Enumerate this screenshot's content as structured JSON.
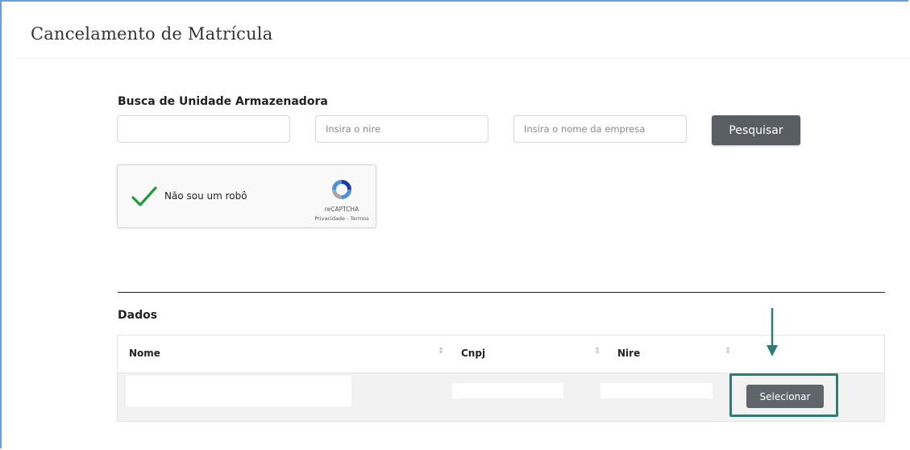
{
  "page": {
    "title": "Cancelamento de Matrícula"
  },
  "search": {
    "heading": "Busca de Unidade Armazenadora",
    "field1_value": "",
    "nire_placeholder": "Insira o nire",
    "empresa_placeholder": "Insira o nome da empresa",
    "button_label": "Pesquisar"
  },
  "captcha": {
    "label": "Não sou um robô",
    "checked": true,
    "brand": "reCAPTCHA",
    "links": "Privacidade - Termos"
  },
  "results": {
    "heading": "Dados",
    "columns": [
      "Nome",
      "Cnpj",
      "Nire",
      ""
    ],
    "rows": [
      {
        "nome": "",
        "cnpj": "",
        "nire": "",
        "action_label": "Selecionar"
      }
    ]
  },
  "colors": {
    "accent_annotation": "#2f7c72",
    "button_bg": "#585e62",
    "frame_border": "#6a9fd1"
  },
  "icons": {
    "sort": "sort-icon",
    "check": "checkmark-icon",
    "recaptcha": "recaptcha-logo-icon",
    "arrow": "arrow-down-icon"
  }
}
